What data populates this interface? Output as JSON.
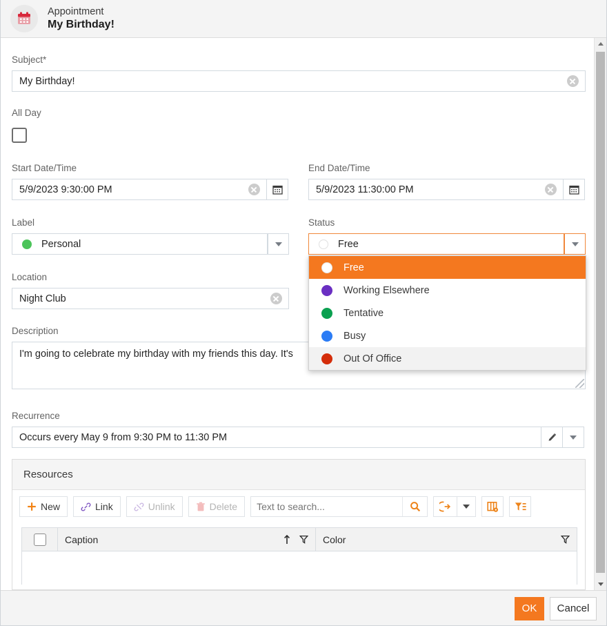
{
  "header": {
    "subtitle": "Appointment",
    "title": "My Birthday!",
    "icon": "calendar-icon"
  },
  "form": {
    "subject": {
      "label": "Subject*",
      "value": "My Birthday!",
      "clear_icon": "clear-circle-icon"
    },
    "all_day": {
      "label": "All Day",
      "checked": false
    },
    "start": {
      "label": "Start Date/Time",
      "value": "5/9/2023 9:30:00 PM",
      "picker_icon": "calendar-icon"
    },
    "end": {
      "label": "End Date/Time",
      "value": "5/9/2023 11:30:00 PM",
      "picker_icon": "calendar-icon"
    },
    "label_field": {
      "label": "Label",
      "value": "Personal",
      "color": "#4cc45a",
      "arrow_icon": "chevron-down-icon"
    },
    "status": {
      "label": "Status",
      "value": "Free",
      "color": "#ffffff",
      "arrow_icon": "chevron-down-icon",
      "focused": true
    },
    "location": {
      "label": "Location",
      "value": "Night Club",
      "clear_icon": "clear-circle-icon"
    },
    "description": {
      "label": "Description",
      "value": "I'm going to celebrate my birthday with my friends this day. It's"
    },
    "recurrence": {
      "label": "Recurrence",
      "value": "Occurs every May 9 from 9:30 PM to 11:30 PM",
      "edit_icon": "pencil-icon",
      "arrow_icon": "chevron-down-icon"
    }
  },
  "status_dropdown": {
    "open": true,
    "options": [
      {
        "label": "Free",
        "color": "#ffffff",
        "state": "selected"
      },
      {
        "label": "Working Elsewhere",
        "color": "#6a2fc2",
        "state": "normal"
      },
      {
        "label": "Tentative",
        "color": "#0aa050",
        "state": "normal"
      },
      {
        "label": "Busy",
        "color": "#2b7cf5",
        "state": "normal"
      },
      {
        "label": "Out Of Office",
        "color": "#d42d0a",
        "state": "hover"
      }
    ]
  },
  "resources": {
    "title": "Resources",
    "toolbar": {
      "new": {
        "label": "New",
        "icon": "plus-icon",
        "enabled": true
      },
      "link": {
        "label": "Link",
        "icon": "link-icon",
        "enabled": true
      },
      "unlink": {
        "label": "Unlink",
        "icon": "unlink-icon",
        "enabled": false
      },
      "delete": {
        "label": "Delete",
        "icon": "trash-icon",
        "enabled": false
      },
      "search": {
        "placeholder": "Text to search...",
        "value": "",
        "icon": "search-icon"
      },
      "export": {
        "icon": "export-icon",
        "arrow_icon": "chevron-down-icon"
      },
      "columns": {
        "icon": "column-chooser-icon"
      },
      "filter": {
        "icon": "filter-editor-icon"
      }
    },
    "grid": {
      "select_all_icon": "checkbox-icon",
      "columns": [
        {
          "title": "Caption",
          "sort_icon": "sort-ascending-icon",
          "filter_icon": "filter-icon"
        },
        {
          "title": "Color",
          "filter_icon": "filter-icon"
        }
      ],
      "rows": []
    }
  },
  "footer": {
    "ok_label": "OK",
    "cancel_label": "Cancel"
  },
  "scrollbar": {
    "up_icon": "scroll-up-icon",
    "down_icon": "scroll-down-icon"
  },
  "colors": {
    "accent": "#f4781f",
    "header_bg": "#f4f4f4",
    "border": "#d3dae0"
  }
}
